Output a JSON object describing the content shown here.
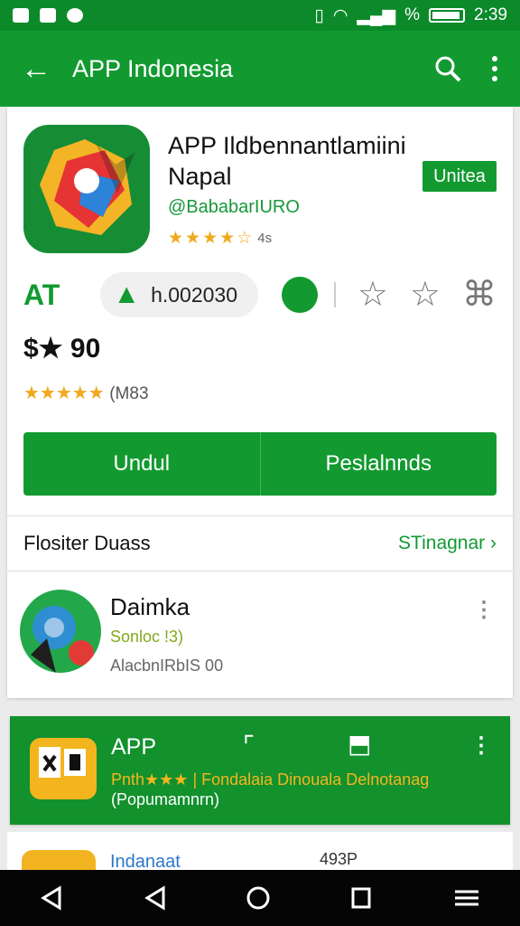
{
  "status": {
    "time": "2:39",
    "signal": "%"
  },
  "app_bar": {
    "title": "APP Indonesia"
  },
  "app": {
    "name_line1": "APP Ildbennantlamiini",
    "name_line2": "Napal",
    "developer": "@BababarIURO",
    "badge": "Unitea",
    "small_rating": "4s",
    "meta_left": "AT",
    "pill_value": "h.002030",
    "rating_text": "$★ 90",
    "rating_count": "(M83",
    "buttons": {
      "left": "Undul",
      "right": "Peslalnnds"
    }
  },
  "section": {
    "title": "Flositer Duass",
    "link": "STinagnar"
  },
  "list_item": {
    "name": "Daimka",
    "rating": "Sonloc !3)",
    "detail": "AlacbnIRbIS 00"
  },
  "promo": {
    "title": "APP",
    "line": "Pnth★★★ | Fondalaia Dinouala Delnotanag",
    "sub": "(Popumamnrn)"
  },
  "bottom": {
    "title": "Indanaat",
    "time": "493P"
  }
}
